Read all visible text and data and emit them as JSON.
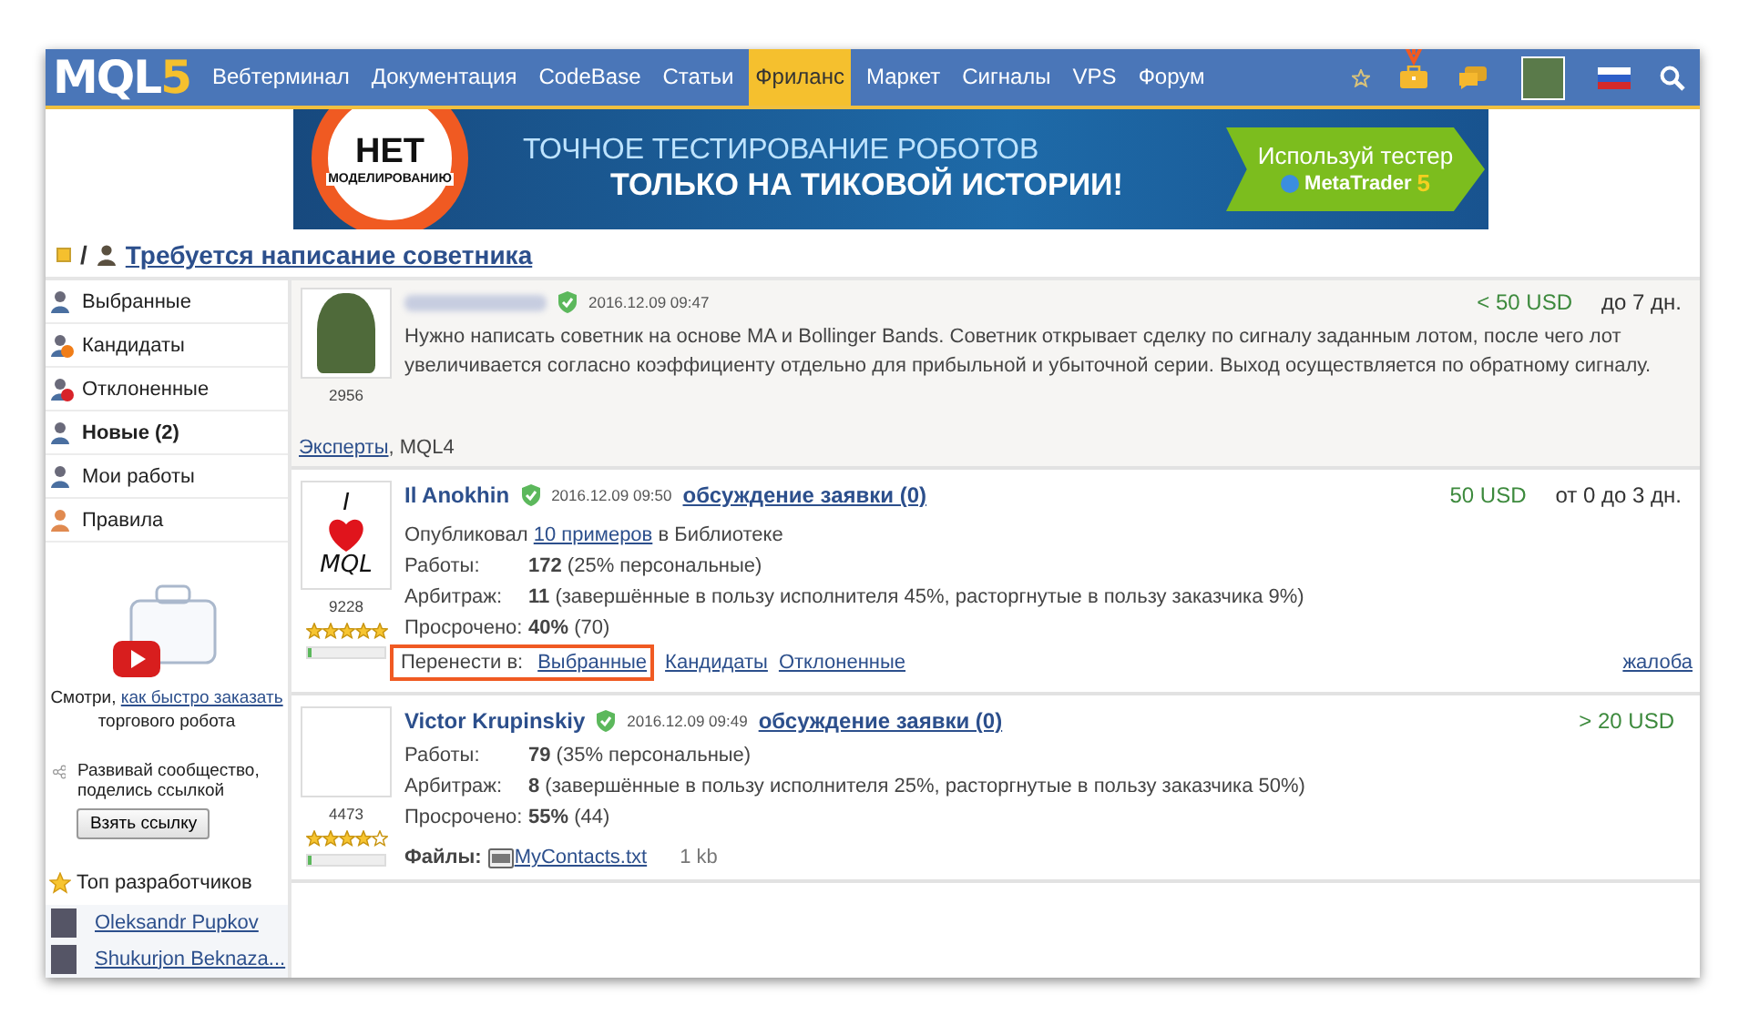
{
  "nav": {
    "logo": {
      "main": "MQL",
      "accent": "5"
    },
    "items": [
      {
        "label": "Вебтерминал",
        "selected": false
      },
      {
        "label": "Документация",
        "selected": false
      },
      {
        "label": "CodeBase",
        "selected": false
      },
      {
        "label": "Статьи",
        "selected": false
      },
      {
        "label": "Фриланс",
        "selected": true
      },
      {
        "label": "Маркет",
        "selected": false
      },
      {
        "label": "Сигналы",
        "selected": false
      },
      {
        "label": "VPS",
        "selected": false
      },
      {
        "label": "Форум",
        "selected": false
      }
    ]
  },
  "banner": {
    "badge_top": "НЕТ",
    "badge_bottom": "МОДЕЛИРОВАНИЮ",
    "line_1": "ТОЧНОЕ ТЕСТИРОВАНИЕ РОБОТОВ",
    "line_2": "ТОЛЬКО НА ТИКОВОЙ ИСТОРИИ!",
    "cta": "Используй тестер",
    "product": "MetaTrader",
    "product_num": "5"
  },
  "breadcrumb": {
    "separator": "/",
    "title": "Требуется написание советника"
  },
  "sidebar": {
    "items": [
      {
        "label": "Выбранные",
        "selected": false
      },
      {
        "label": "Кандидаты",
        "selected": false
      },
      {
        "label": "Отклоненные",
        "selected": false
      },
      {
        "label": "Новые (2)",
        "selected": true
      },
      {
        "label": "Мои работы",
        "selected": false
      },
      {
        "label": "Правила",
        "selected": false
      }
    ],
    "promo": {
      "before": "Смотри,",
      "link": "как быстро заказать",
      "after": "торгового робота"
    },
    "share": {
      "text": "Развивай сообщество, поделись ссылкой",
      "button": "Взять ссылку"
    },
    "top": {
      "title": "Топ разработчиков",
      "developers": [
        "Oleksandr Pupkov",
        "Shukurjon Beknaza..."
      ]
    }
  },
  "order": {
    "date": "2016.12.09 09:47",
    "text": "Нужно написать советник на основе MA и Bollinger Bands. Советник открывает сделку по сигналу заданным лотом, после чего лот увеличивается согласно коэффициенту отдельно для прибыльной и убыточной серии. Выход осуществляется по обратному сигналу.",
    "price": "< 50 USD",
    "term": "до 7 дн.",
    "rating": "2956",
    "tag_link": "Эксперты",
    "tag_rest": ", MQL4"
  },
  "applicants": [
    {
      "name": "Il Anokhin",
      "date": "2016.12.09 09:50",
      "discussion": "обсуждение заявки (0)",
      "price": "50 USD",
      "term": "от 0 до 3 дн.",
      "rating": "9228",
      "stars": 5,
      "level": 0.05,
      "avatar": {
        "line_1": "I",
        "line_2": "MQL"
      },
      "published": {
        "before": "Опубликовал",
        "link": "10 примеров",
        "after": "в Библиотеке"
      },
      "stats": [
        {
          "label": "Работы:",
          "value": "**172** (25% персональные)"
        },
        {
          "label": "Арбитраж:",
          "value": "**11** (завершённые в пользу исполнителя 45%, расторгнутые в пользу заказчика 9%)"
        },
        {
          "label": "Просрочено:",
          "value": "**40%** (70)"
        }
      ],
      "move": {
        "label": "Перенести в:",
        "links": [
          "Выбранные",
          "Кандидаты",
          "Отклоненные"
        ]
      },
      "complaint": "жалоба"
    },
    {
      "name": "Victor Krupinskiy",
      "date": "2016.12.09 09:49",
      "discussion": "обсуждение заявки (0)",
      "price": "> 20 USD",
      "rating": "4473",
      "stars": 4,
      "level": 0.05,
      "stats": [
        {
          "label": "Работы:",
          "value": "**79** (35% персональные)"
        },
        {
          "label": "Арбитраж:",
          "value": "**8** (завершённые в пользу исполнителя 25%, расторгнутые в пользу заказчика 50%)"
        },
        {
          "label": "Просрочено:",
          "value": "**55%** (44)"
        }
      ],
      "files": {
        "label": "Файлы:",
        "name": "MyContacts.txt",
        "size": "1 kb"
      }
    }
  ]
}
